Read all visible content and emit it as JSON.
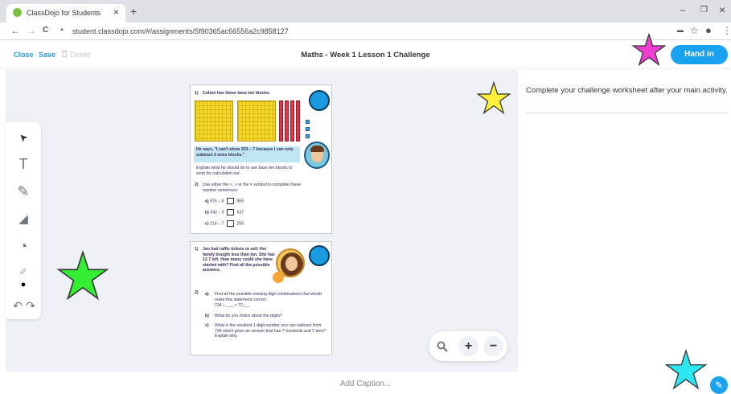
{
  "browser": {
    "tab_title": "ClassDojo for Students",
    "tab_close": "×",
    "new_tab": "+",
    "url": "student.classdojo.com/#/assignments/5f90365ac66556a2c9858127",
    "win_min": "–",
    "win_restore": "❐",
    "win_close": "×",
    "nav_back": "←",
    "nav_forward": "→",
    "nav_reload": "C",
    "lock": "▲",
    "cast": "▬",
    "bookmark": "☆",
    "profile": "●",
    "menu": "⋮"
  },
  "header": {
    "close_label": "Close",
    "save_label": "Save",
    "delete_label": "Delete",
    "title": "Maths - Week 1 Lesson 1 Challenge",
    "hand_in_label": "Hand in"
  },
  "panel": {
    "instructions": "Complete your challenge worksheet after your main activity."
  },
  "toolbar": {
    "select_icon": "➤",
    "text_icon": "T",
    "pen_icon": "✎",
    "eraser_icon": "◢",
    "shape_icon": "◔",
    "dropper_icon": "✐",
    "color_icon": "●",
    "undo_icon": "↶",
    "redo_icon": "↷"
  },
  "worksheet1": {
    "q1_num": "1)",
    "q1_text": "Colton has these base ten blocks:",
    "speech": "He says, \"I can't show 233 – 7 because I can only subtract 3 ones blocks.\"",
    "explain": "Explain what he should do to use base ten blocks to work his calculation out.",
    "q2_num": "2)",
    "q2_text": "Use either the <, > or the = symbol to complete these number sentences:",
    "a_label": "a)",
    "a_left": "876 – 8",
    "a_right": "869",
    "b_label": "b)",
    "b_left": "642 – 5",
    "b_right": "637",
    "c_label": "c)",
    "c_left": "214 – 7",
    "c_right": "208"
  },
  "worksheet2": {
    "q1_num": "1)",
    "q1_text": "Jen had raffle tickets to sell. Her family bought less than ten. She has 13 7 left. How many could she have started with? Find all the possible answers.",
    "q2_num": "2)",
    "a_label": "a)",
    "a_text": "Find all the possible missing digit combinations that would make this statement correct:",
    "a_expr": "734 – ___ > 72___",
    "b_label": "b)",
    "b_text": "What do you notice about the digits?",
    "c_label": "c)",
    "c_text": "What is the smallest 1-digit number you can subtract from 734 which gives an answer that has 7 hundreds and 2 tens? Explain why."
  },
  "zoom": {
    "search_icon": "🔍︎",
    "plus": "+",
    "minus": "−"
  },
  "caption_placeholder": "Add Caption...",
  "colors": {
    "accent": "#19a2f0",
    "star_magenta": "#ee3dd0",
    "star_yellow": "#fff238",
    "star_green": "#33ee33",
    "star_cyan": "#2ee6f0"
  }
}
